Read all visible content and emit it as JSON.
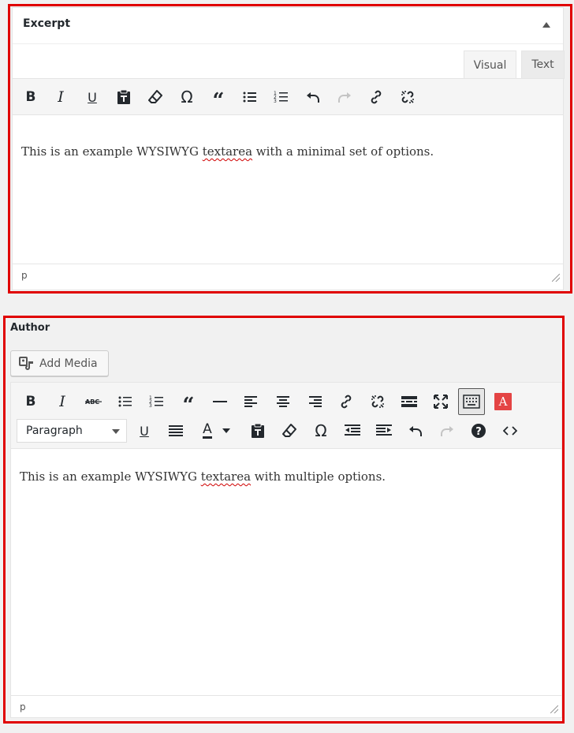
{
  "excerpt": {
    "title": "Excerpt",
    "tabs": {
      "visual": "Visual",
      "text": "Text"
    },
    "toolbar": [
      "bold-icon",
      "italic-icon",
      "underline-icon",
      "paste-text-icon",
      "clear-formatting-icon",
      "special-character-icon",
      "blockquote-icon",
      "bullet-list-icon",
      "numbered-list-icon",
      "undo-icon",
      "redo-icon",
      "insert-link-icon",
      "remove-link-icon"
    ],
    "content_prefix": "This is an example WYSIWYG ",
    "content_misspelled": "textarea",
    "content_suffix": " with a minimal set of options.",
    "path": "p"
  },
  "author": {
    "title": "Author",
    "add_media_label": "Add Media",
    "format_selected": "Paragraph",
    "content_prefix": "This is an example WYSIWYG ",
    "content_misspelled": "textarea",
    "content_suffix": " with multiple options.",
    "path": "p",
    "text_color_letter": "A",
    "red_button_letter": "A",
    "red_button_color": "#e44444"
  },
  "colors": {
    "frame": "#e00000",
    "background": "#f1f1f1",
    "toolbar": "#f5f5f5"
  }
}
